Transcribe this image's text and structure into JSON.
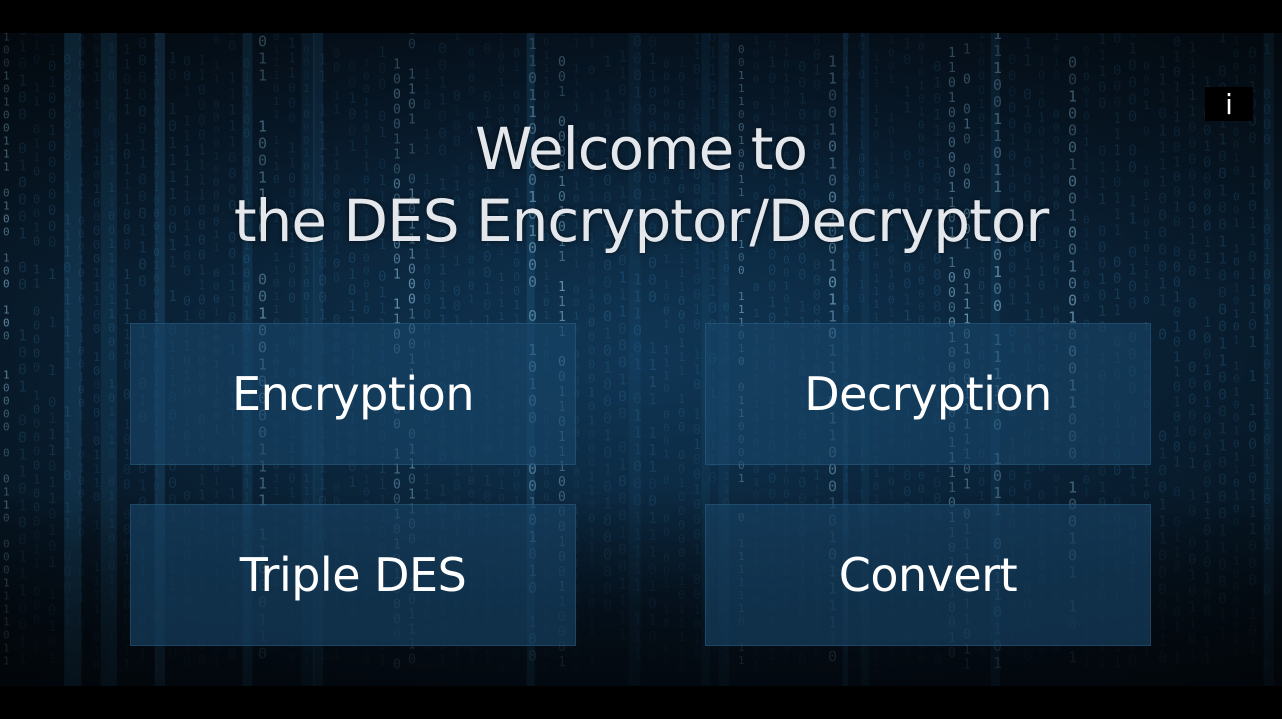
{
  "title": {
    "line1": "Welcome to",
    "line2": "the DES Encryptor/Decryptor"
  },
  "buttons": {
    "encryption": "Encryption",
    "decryption": "Decryption",
    "triple_des": "Triple DES",
    "convert": "Convert"
  },
  "info_button": {
    "label": "i"
  },
  "background": {
    "theme": "binary-matrix",
    "colors": {
      "dark": "#071522",
      "mid": "#0b2438",
      "glow": "#4fb3e8",
      "button_fill": "#194669"
    }
  }
}
